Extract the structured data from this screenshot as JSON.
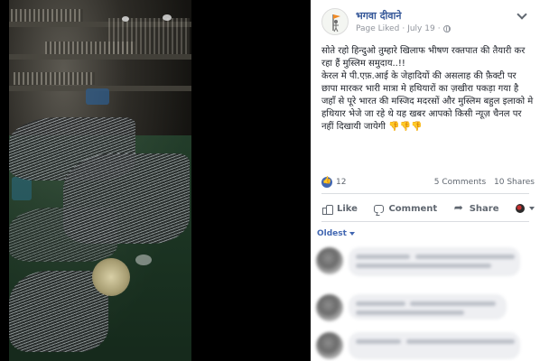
{
  "post": {
    "page_name": "भगवा दीवाने",
    "meta_label": "Page Liked",
    "meta_sep": "·",
    "date": "July 19",
    "meta_sep2": "·",
    "text": "सोते रहो हिन्दुओ तुम्हारे खिलाफ भीषण रक्तपात की तैयारी कर रहा हैं मुस्लिम समुदाय..!!\nकेरल मे पी.एफ़.आई के जेहादियों की असलाह की फ़ैक्टी पर छापा मारकर भारी मात्रा मे हथियारों का ज़खीरा पकड़ा गया है जहाँ से पूरे भारत की मस्जिद मदरसों और मुस्लिम बहुल इलाको मे हथियार भेजे जा रहे थे यह खबर आपको किसी न्यूज़ चैनल पर नहीं दिखायी जायेगी 👎👎👎"
  },
  "stats": {
    "likes": "12",
    "comments": "5 Comments",
    "shares": "10 Shares"
  },
  "actions": {
    "like": "Like",
    "comment": "Comment",
    "share": "Share"
  },
  "comments_sort": "Oldest",
  "icons": {
    "page_icon": "flag-figure-icon",
    "privacy": "globe-icon",
    "menu": "chevron-down-icon",
    "reaction": "thumbs-up-icon"
  },
  "colors": {
    "link": "#365899",
    "accent": "#4267b2",
    "muted": "#90949c"
  }
}
